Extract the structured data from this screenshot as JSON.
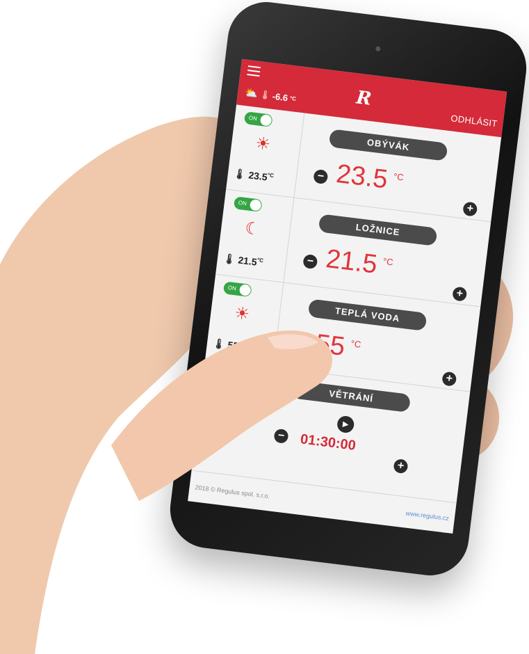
{
  "header": {
    "logo": "R",
    "logout": "ODHLÁSIT"
  },
  "weather": {
    "outdoor_temp": "-6.6",
    "unit": "°C",
    "icon": "partly-cloudy-icon"
  },
  "zones": [
    {
      "toggle": "ON",
      "mode_icon": "sun-icon",
      "mode_glyph": "☀",
      "room_temp": "23.5",
      "room_unit": "°C",
      "title": "OBÝVÁK",
      "setpoint": "23.5",
      "unit": "°C",
      "minus": "−",
      "plus": "+"
    },
    {
      "toggle": "ON",
      "mode_icon": "moon-icon",
      "mode_glyph": "☾",
      "room_temp": "21.5",
      "room_unit": "°C",
      "title": "LOŽNICE",
      "setpoint": "21.5",
      "unit": "°C",
      "minus": "−",
      "plus": "+"
    },
    {
      "toggle": "ON",
      "mode_icon": "sun-icon",
      "mode_glyph": "☀",
      "room_temp": "55",
      "room_unit": "°C",
      "title": "TEPLÁ VODA",
      "setpoint": "55",
      "unit": "°C",
      "minus": "−",
      "plus": "+"
    }
  ],
  "ventilation": {
    "title": "VĚTRÁNÍ",
    "timer": "01:30:00",
    "minus": "−",
    "plus": "+"
  },
  "footer": {
    "copyright": "2018 © Regulus spol. s.r.o.",
    "website": "www.regulus.cz"
  },
  "colors": {
    "accent": "#d42a39",
    "setpoint": "#e1353b",
    "toggle_on": "#35a544"
  }
}
